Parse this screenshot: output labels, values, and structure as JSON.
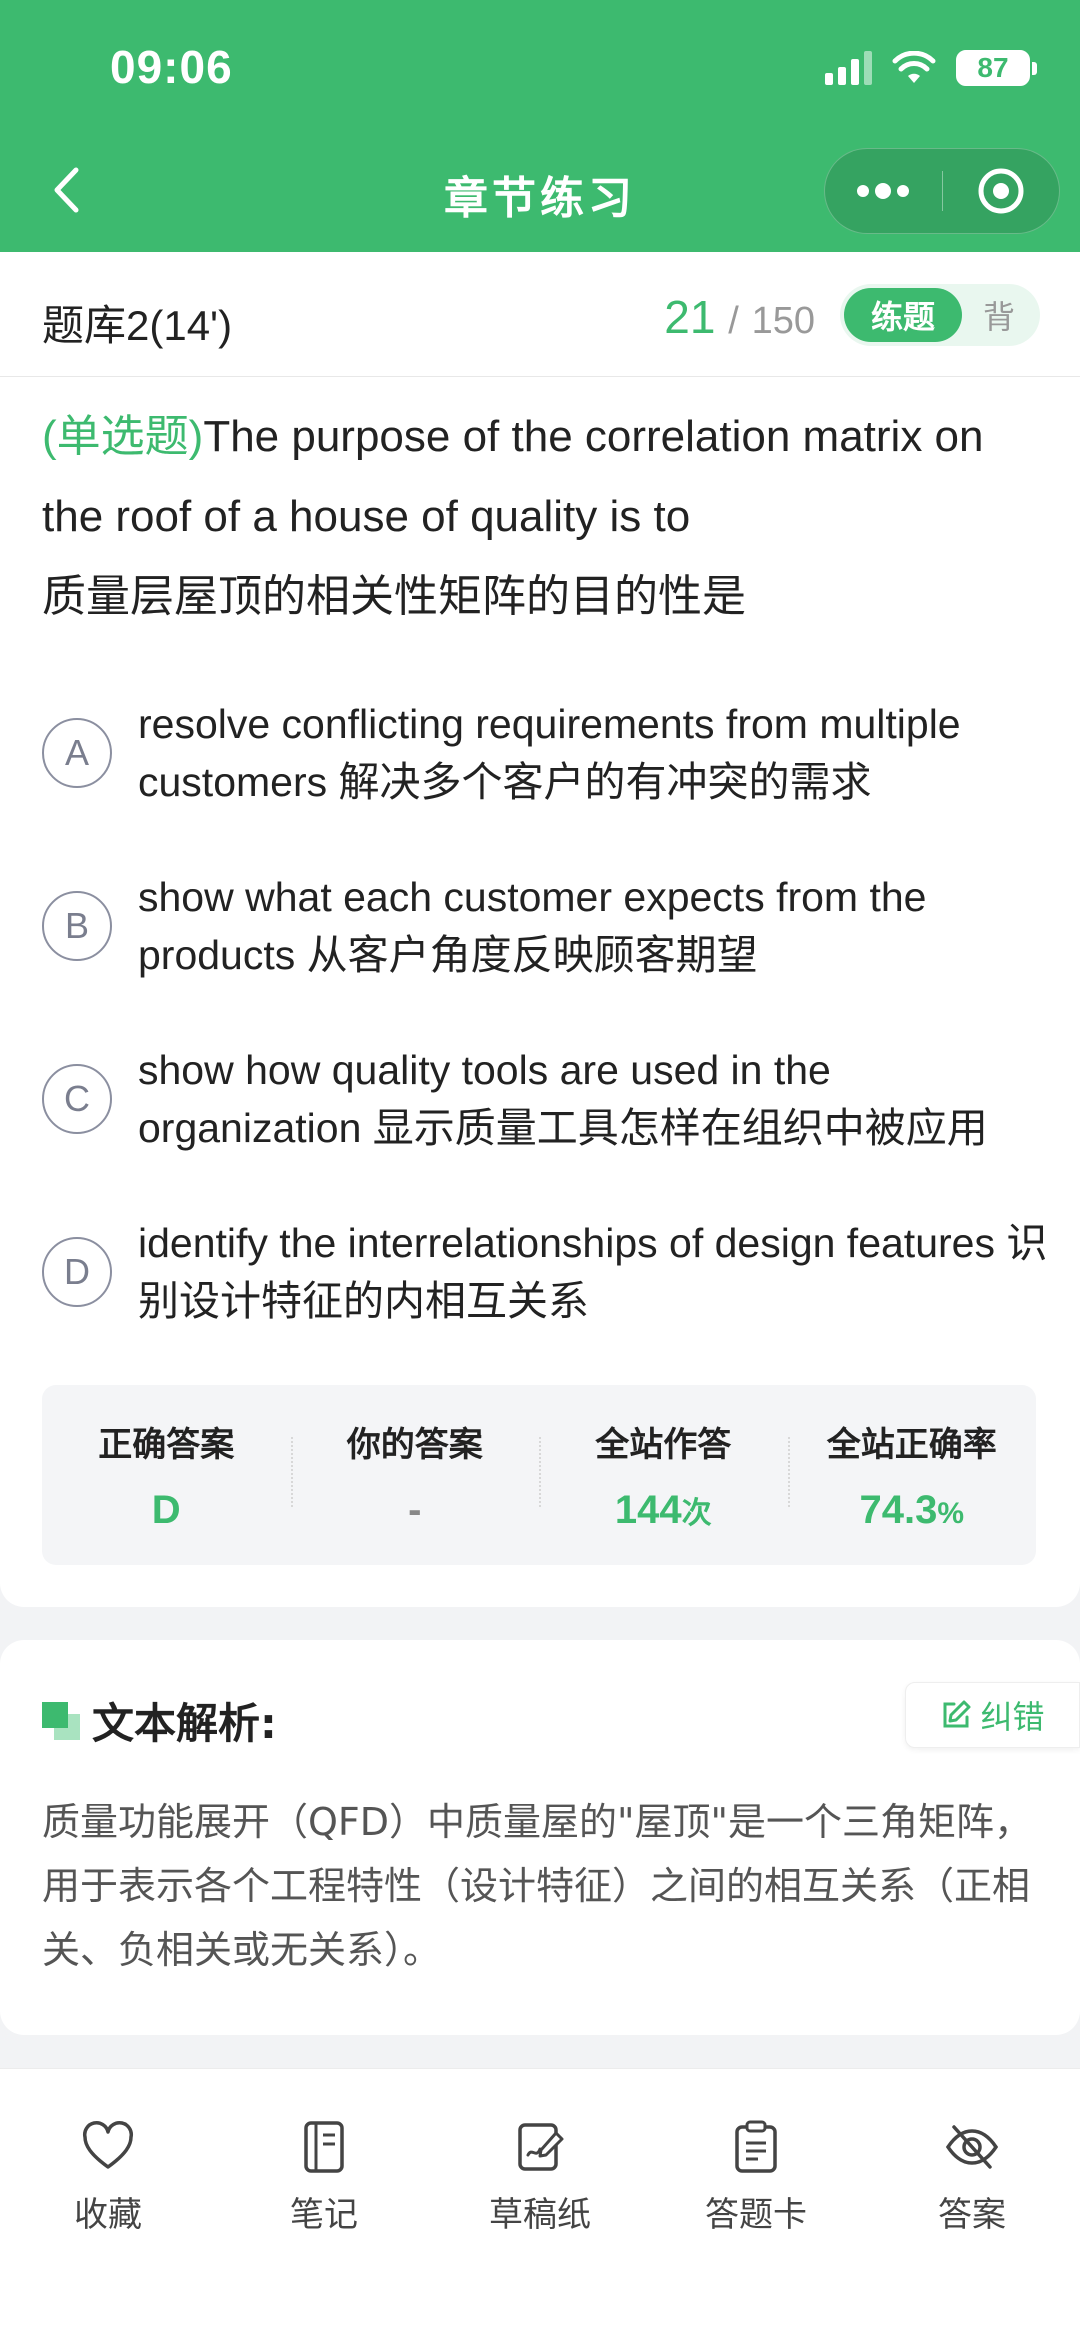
{
  "status_bar": {
    "time": "09:06",
    "battery": "87"
  },
  "nav": {
    "title": "章节练习"
  },
  "bank": {
    "name": "题库2(14')",
    "current": "21",
    "separator": "/",
    "total": "150",
    "mode_active": "练题",
    "mode_inactive": "背"
  },
  "question": {
    "type_label": "(单选题)",
    "text": "The purpose of the correlation matrix on the roof of a house of quality is to",
    "text_cn": "质量层屋顶的相关性矩阵的目的性是",
    "options": [
      {
        "letter": "A",
        "text": "resolve conflicting requirements from multiple customers 解决多个客户的有冲突的需求"
      },
      {
        "letter": "B",
        "text": "show what each customer expects from the products 从客户角度反映顾客期望"
      },
      {
        "letter": "C",
        "text": "show how quality tools are used in the organization 显示质量工具怎样在组织中被应用"
      },
      {
        "letter": "D",
        "text": "identify the interrelationships of design features 识别设计特征的内相互关系"
      }
    ]
  },
  "stats": {
    "correct_label": "正确答案",
    "correct_value": "D",
    "yours_label": "你的答案",
    "yours_value": "-",
    "site_answers_label": "全站作答",
    "site_answers_value": "144",
    "site_answers_unit": "次",
    "site_rate_label": "全站正确率",
    "site_rate_value": "74.3",
    "site_rate_unit": "%"
  },
  "analysis": {
    "title": "文本解析:",
    "report_label": "纠错",
    "body": "质量功能展开（QFD）中质量屋的\"屋顶\"是一个三角矩阵，用于表示各个工程特性（设计特征）之间的相互关系（正相关、负相关或无关系）。"
  },
  "bottom_tabs": [
    {
      "label": "收藏",
      "icon": "heart-icon"
    },
    {
      "label": "笔记",
      "icon": "notebook-icon"
    },
    {
      "label": "草稿纸",
      "icon": "draft-icon"
    },
    {
      "label": "答题卡",
      "icon": "clipboard-icon"
    },
    {
      "label": "答案",
      "icon": "eye-off-icon"
    }
  ],
  "colors": {
    "primary": "#3dba6f",
    "primary_light": "#e9f7ef"
  }
}
